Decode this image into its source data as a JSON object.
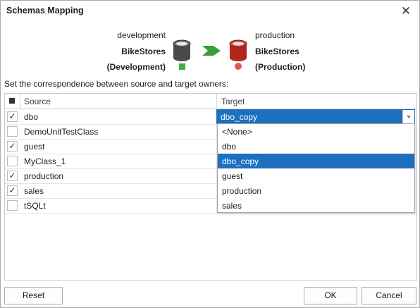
{
  "dialog": {
    "title": "Schemas Mapping",
    "close_label": "✕"
  },
  "source": {
    "server": "development",
    "database": "BikeStores",
    "connection": "(Development)",
    "color": "#3cb043"
  },
  "target": {
    "server": "production",
    "database": "BikeStores",
    "connection": "(Production)",
    "color": "#e8554e"
  },
  "instruction": "Set the correspondence between source and target owners:",
  "grid": {
    "columns": {
      "source": "Source",
      "target": "Target"
    },
    "rows": [
      {
        "checked": true,
        "source": "dbo",
        "target": "dbo_copy"
      },
      {
        "checked": false,
        "source": "DemoUnitTestClass",
        "target": ""
      },
      {
        "checked": true,
        "source": "guest",
        "target": ""
      },
      {
        "checked": false,
        "source": "MyClass_1",
        "target": ""
      },
      {
        "checked": true,
        "source": "production",
        "target": ""
      },
      {
        "checked": true,
        "source": "sales",
        "target": ""
      },
      {
        "checked": false,
        "source": "tSQLt",
        "target": ""
      }
    ],
    "check_mark": "✓"
  },
  "combo": {
    "value": "dbo_copy"
  },
  "dropdown": {
    "options": [
      "<None>",
      "dbo",
      "dbo_copy",
      "guest",
      "production",
      "sales"
    ],
    "selected": "dbo_copy"
  },
  "buttons": {
    "reset": "Reset",
    "ok": "OK",
    "cancel": "Cancel"
  },
  "colors": {
    "selection": "#1e6fbf",
    "arrow": "#3a9d3a",
    "source_db": "#4a4a4a",
    "target_db": "#b3261e"
  }
}
